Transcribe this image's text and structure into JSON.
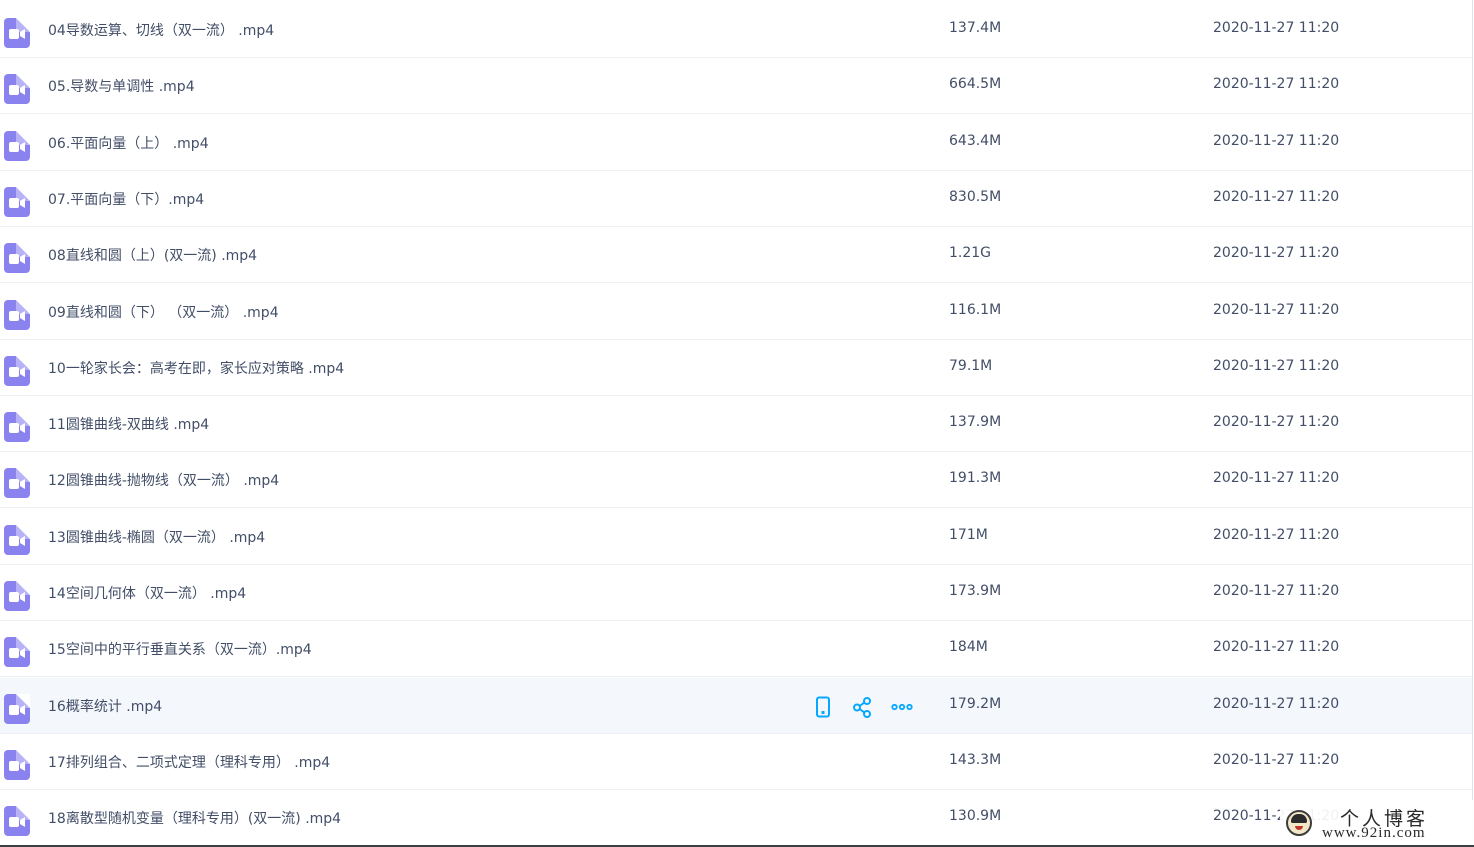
{
  "colors": {
    "video_icon": "#8a83ef",
    "action_icon": "#06a7ff",
    "text": "#424e67",
    "hover_row": "#f4f8fd"
  },
  "files": [
    {
      "name": "04导数运算、切线（双一流） .mp4",
      "size": "137.4M",
      "date": "2020-11-27 11:20",
      "icon": "video-file-icon"
    },
    {
      "name": "05.导数与单调性 .mp4",
      "size": "664.5M",
      "date": "2020-11-27 11:20",
      "icon": "video-file-icon"
    },
    {
      "name": "06.平面向量（上） .mp4",
      "size": "643.4M",
      "date": "2020-11-27 11:20",
      "icon": "video-file-icon"
    },
    {
      "name": "07.平面向量（下）.mp4",
      "size": "830.5M",
      "date": "2020-11-27 11:20",
      "icon": "video-file-icon"
    },
    {
      "name": "08直线和圆（上）(双一流) .mp4",
      "size": "1.21G",
      "date": "2020-11-27 11:20",
      "icon": "video-file-icon"
    },
    {
      "name": "09直线和圆（下） （双一流） .mp4",
      "size": "116.1M",
      "date": "2020-11-27 11:20",
      "icon": "video-file-icon"
    },
    {
      "name": "10一轮家长会：高考在即，家长应对策略 .mp4",
      "size": "79.1M",
      "date": "2020-11-27 11:20",
      "icon": "video-file-icon"
    },
    {
      "name": "11圆锥曲线-双曲线 .mp4",
      "size": "137.9M",
      "date": "2020-11-27 11:20",
      "icon": "video-file-icon"
    },
    {
      "name": "12圆锥曲线-抛物线（双一流） .mp4",
      "size": "191.3M",
      "date": "2020-11-27 11:20",
      "icon": "video-file-icon"
    },
    {
      "name": "13圆锥曲线-椭圆（双一流） .mp4",
      "size": "171M",
      "date": "2020-11-27 11:20",
      "icon": "video-file-icon"
    },
    {
      "name": "14空间几何体（双一流） .mp4",
      "size": "173.9M",
      "date": "2020-11-27 11:20",
      "icon": "video-file-icon"
    },
    {
      "name": "15空间中的平行垂直关系（双一流）.mp4",
      "size": "184M",
      "date": "2020-11-27 11:20",
      "icon": "video-file-icon"
    },
    {
      "name": "16概率统计 .mp4",
      "size": "179.2M",
      "date": "2020-11-27 11:20",
      "icon": "video-file-icon",
      "hovered": true
    },
    {
      "name": "17排列组合、二项式定理（理科专用） .mp4",
      "size": "143.3M",
      "date": "2020-11-27 11:20",
      "icon": "video-file-icon"
    },
    {
      "name": "18离散型随机变量（理科专用）(双一流) .mp4",
      "size": "130.9M",
      "date": "2020-11-27 11:20",
      "icon": "video-file-icon"
    }
  ],
  "row_actions": [
    "phone-icon",
    "share-icon",
    "more-icon"
  ],
  "watermark": {
    "title": "个人博客",
    "url": "www.92in.com"
  }
}
